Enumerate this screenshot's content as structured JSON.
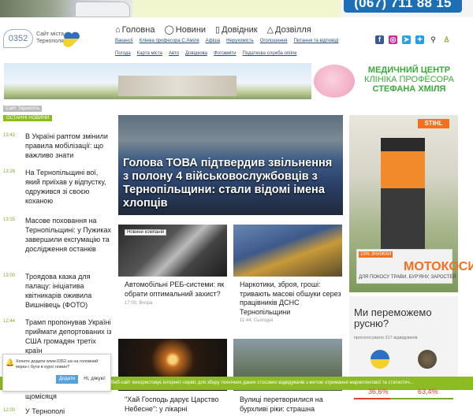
{
  "top": {
    "phone": "(067) 711 88 15"
  },
  "logo": {
    "number": "0352",
    "text": "Сайт міста Тернополя"
  },
  "nav": {
    "main": [
      {
        "label": "Головна",
        "icon": "home-icon"
      },
      {
        "label": "Новини",
        "icon": "chat-icon"
      },
      {
        "label": "Довідник",
        "icon": "book-icon"
      },
      {
        "label": "Дозвілля",
        "icon": "tent-icon"
      }
    ],
    "sub1": [
      "Вакансії",
      "Клініка професора С.Хміля",
      "Афіша",
      "Нерухомість",
      "Оголошення",
      "Питання та відповіді"
    ],
    "sub2": [
      "Погода",
      "Карта міста",
      "Авто",
      "Довідкова",
      "Фотовміти",
      "Податкова служба online"
    ]
  },
  "hero": {
    "banner_line1": "МЕДИЧНИЙ ЦЕНТР",
    "banner_line2": "КЛІНІКА ПРОФЕСОРА",
    "banner_line3": "СТЕФАНА ХМІЛЯ"
  },
  "left": {
    "section": "Сайт Тернопіль",
    "label": "ОСТАННІ НОВИНИ",
    "items": [
      {
        "time": "13:43",
        "title": "В Україні раптом змінили правила мобілізації: що важливо знати"
      },
      {
        "time": "13:28",
        "title": "На Тернопільщині вої, який приїхав у відпустку, одружився зі своєю коханою"
      },
      {
        "time": "13:15",
        "title": "Масове поховання на Тернопільщині: у Пужиках завершили ексгумацію та дослідження останків"
      },
      {
        "time": "13:00",
        "title": "Троядова казка для палацу: ініціатива квітникарів оживила Вишнівець (ФОТО)"
      },
      {
        "time": "12:44",
        "title": "Трамп пропонував Україні приймати депортованих із США громадян третіх країн"
      },
      {
        "time": "",
        "title": "щомісяця"
      },
      {
        "time": "12:00",
        "title": "У Тернополі"
      }
    ]
  },
  "main": {
    "big_title": "Голова ТОВА підтвердив звільнення з полону 4 військовослужбовців з Тернопільщини: стали відомі імена хлопців",
    "card1": {
      "tag": "Новини компаній",
      "title": "Автомобільні РЕБ-системи: як обрати оптимальний захист?",
      "meta": "17:00, Вчора"
    },
    "card2": {
      "title": "Наркотики, зброя, гроші: тривають масові обшуки серез працівників ДСНС Тернопільщини",
      "meta": "11:44, Сьогодні"
    },
    "card3": {
      "title": "\"Хай Господь дарує Царство Небесне\": у лікарні"
    },
    "card4": {
      "title": "Вулиці перетворилися на бурхливі ріки: страшна"
    }
  },
  "ad": {
    "brand": "STIHL",
    "discount": "10% ЗНИЖКИ",
    "big": "МОТОКОСИ",
    "small": "ДЛЯ ПОКОСУ ТРАВИ, БУР'ЯНУ, ЗАРОСТЕЙ"
  },
  "poll": {
    "question": "Ми переможемо русню?",
    "sub": "проголосувало 317 відвідувачів",
    "pct1": "36,6%",
    "pct2": "63,4%"
  },
  "cookie": {
    "text": "Веб-сайт використовує інтернет-сервіс для збору технічних даних стосовно відвідувачів з метою отримання маркетингової та статистич..."
  },
  "push": {
    "text": "Хочете додати www.0352.ua на головний екран і бути в курсі новин?",
    "ok": "Додати",
    "no": "Ні, дякую!"
  },
  "colors": {
    "accent": "#8dbb22",
    "brand_blue": "#1d6fb5"
  }
}
